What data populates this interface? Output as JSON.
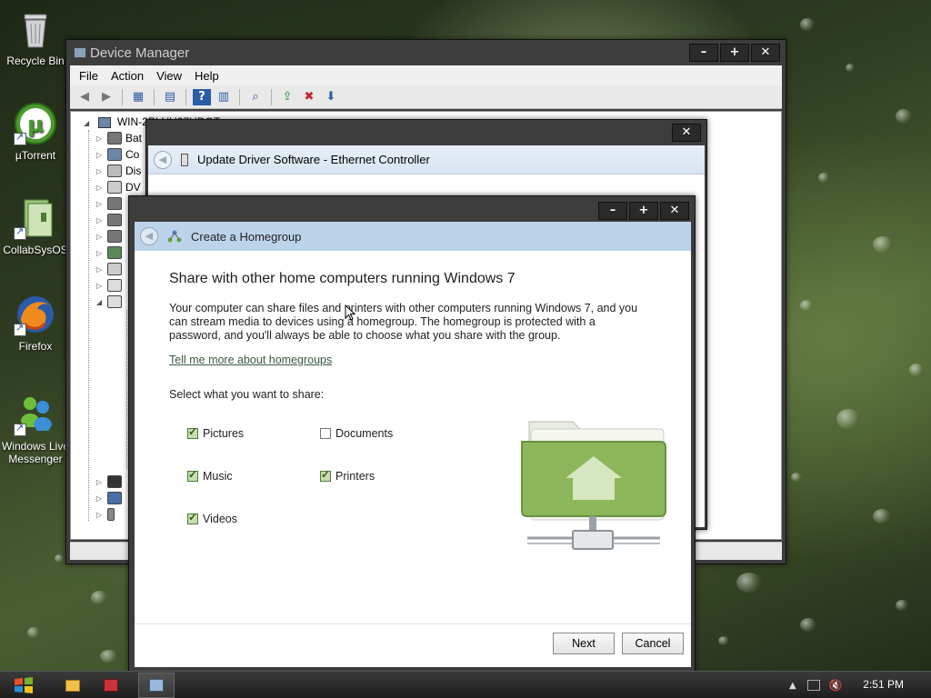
{
  "desktop": {
    "icons": [
      {
        "label": "Recycle Bin",
        "icon": "recycle-bin-icon"
      },
      {
        "label": "µTorrent",
        "icon": "utorrent-icon"
      },
      {
        "label": "CollabSysOS",
        "icon": "collabsysos-icon"
      },
      {
        "label": "Firefox",
        "icon": "firefox-icon"
      },
      {
        "label": "Windows Live Messenger",
        "icon": "windows-live-messenger-icon"
      }
    ]
  },
  "device_manager": {
    "title": "Device Manager",
    "menu": [
      "File",
      "Action",
      "View",
      "Help"
    ],
    "tree_root": "WIN-2PLHU27UDOT",
    "tree_items": [
      "Bat",
      "Co",
      "Dis",
      "DV",
      "",
      "",
      "",
      "",
      "",
      "",
      "",
      "",
      "",
      "",
      ""
    ]
  },
  "update_driver": {
    "title": "Update Driver Software - Ethernet Controller"
  },
  "homegroup": {
    "title": "Create a Homegroup",
    "heading": "Share with other home computers running Windows 7",
    "description": "Your computer can share files and printers with other computers running Windows 7, and you can stream media to devices using a homegroup. The homegroup is protected with a password, and you'll always be able to choose what you share with the group.",
    "link": "Tell me more about homegroups",
    "select_label": "Select what you want to share:",
    "options": [
      {
        "label": "Pictures",
        "checked": true
      },
      {
        "label": "Documents",
        "checked": false
      },
      {
        "label": "Music",
        "checked": true
      },
      {
        "label": "Printers",
        "checked": true
      },
      {
        "label": "Videos",
        "checked": true
      }
    ],
    "next_label": "Next",
    "cancel_label": "Cancel"
  },
  "taskbar": {
    "clock": "2:51 PM"
  },
  "colors": {
    "header_blue": "#bcd3ea",
    "folder_green": "#8db55a",
    "link_green": "#3c5a40"
  }
}
